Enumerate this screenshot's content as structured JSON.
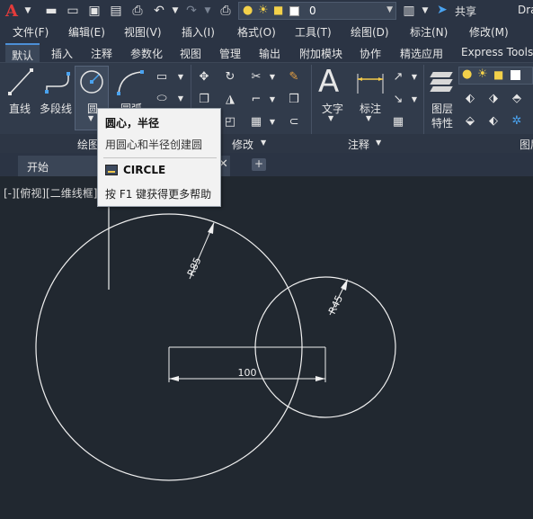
{
  "qat": {
    "layer_value": "0",
    "share_label": "共享",
    "title_fragment": "Dra"
  },
  "menu": [
    "文件(F)",
    "编辑(E)",
    "视图(V)",
    "插入(I)",
    "格式(O)",
    "工具(T)",
    "绘图(D)",
    "标注(N)",
    "修改(M)"
  ],
  "ribbon_tabs": [
    "默认",
    "插入",
    "注释",
    "参数化",
    "视图",
    "管理",
    "输出",
    "附加模块",
    "协作",
    "精选应用",
    "Express Tools"
  ],
  "ribbon": {
    "line": "直线",
    "polyline": "多段线",
    "circle": "圆",
    "arc": "圆弧",
    "text": "文字",
    "dimension": "标注",
    "layer_props_1": "图层",
    "layer_props_2": "特性",
    "panel_draw": "绘图",
    "panel_modify": "修改",
    "panel_annotate": "注释",
    "panel_layers_frag": "图层"
  },
  "file_tabs": {
    "start": "开始"
  },
  "viewport_label": "[-][俯视][二维线框]",
  "tooltip": {
    "title": "圆心，半径",
    "description": "用圆心和半径创建圆",
    "command": "CIRCLE",
    "help": "按 F1 键获得更多帮助"
  },
  "drawing": {
    "large_radius_label": "R85",
    "small_radius_label": "R45",
    "distance_label": "100"
  },
  "colors": {
    "background": "#212830",
    "ribbon": "#313b4b",
    "accent": "#4c8fd6",
    "geometry": "#f0f0f0"
  }
}
